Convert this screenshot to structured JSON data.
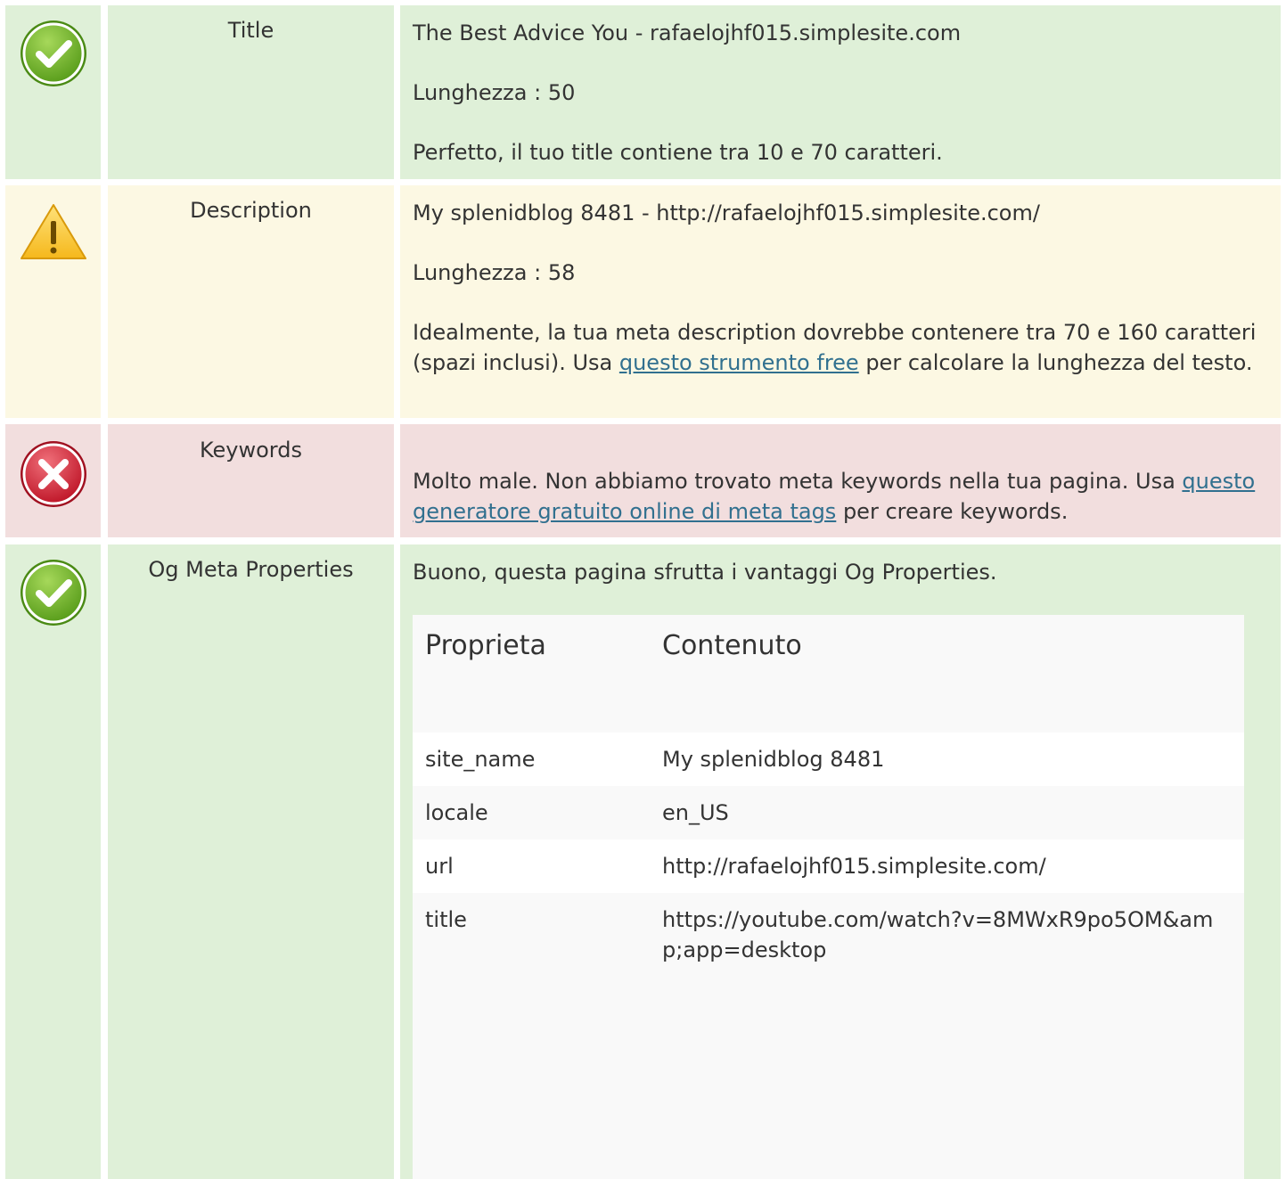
{
  "rows": {
    "title": {
      "label": "Title",
      "value": "The Best Advice You - rafaelojhf015.simplesite.com",
      "length": "Lunghezza : 50",
      "message": "Perfetto, il tuo title contiene tra 10 e 70 caratteri."
    },
    "description": {
      "label": "Description",
      "value": "My splenidblog 8481 - http://rafaelojhf015.simplesite.com/",
      "length": "Lunghezza : 58",
      "message_part1": "Idealmente, la tua meta description dovrebbe contenere tra 70 e 160 caratteri (spazi inclusi). Usa ",
      "message_link": "questo strumento free",
      "message_part2": " per calcolare la lunghezza del testo."
    },
    "keywords": {
      "label": "Keywords",
      "message_part1": "Molto male. Non abbiamo trovato meta keywords nella tua pagina. Usa ",
      "message_link": "questo generatore gratuito online di meta tags",
      "message_part2": " per creare keywords."
    },
    "og": {
      "label": "Og Meta Properties",
      "message": "Buono, questa pagina sfrutta i vantaggi Og Properties.",
      "table": {
        "col_property": "Proprieta",
        "col_content": "Contenuto",
        "rows": [
          {
            "property": "site_name",
            "content": "My splenidblog 8481"
          },
          {
            "property": "locale",
            "content": "en_US"
          },
          {
            "property": "url",
            "content": "http://rafaelojhf015.simplesite.com/"
          },
          {
            "property": "title",
            "content": "https://youtube.com/watch?v=8MWxR9po5OM&amp;app=desktop"
          }
        ]
      }
    }
  },
  "icons": {
    "ok": "check-circle-icon",
    "warn": "warning-triangle-icon",
    "err": "error-circle-icon"
  },
  "colors": {
    "ok_bg": "#dff0d8",
    "warn_bg": "#fcf8e3",
    "err_bg": "#f2dede",
    "link": "#31708f"
  }
}
